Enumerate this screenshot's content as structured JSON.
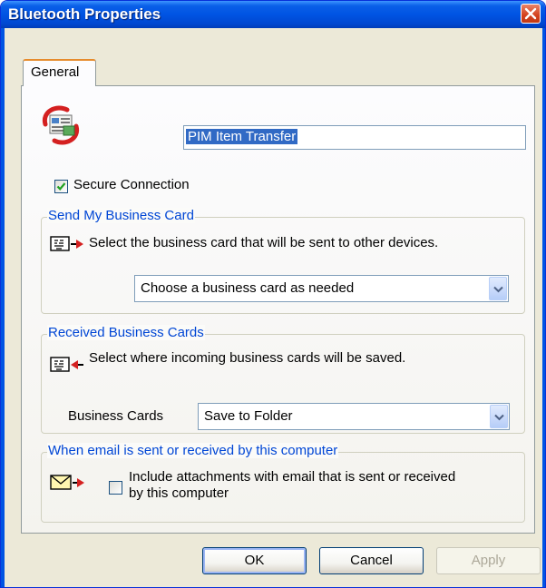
{
  "window": {
    "title": "Bluetooth Properties",
    "close_icon": "close-icon"
  },
  "tabs": [
    {
      "label": "General",
      "selected": true
    }
  ],
  "service": {
    "icon": "pim-transfer-icon",
    "name": "PIM Item Transfer"
  },
  "secure_connection": {
    "label": "Secure Connection",
    "checked": true
  },
  "send_card": {
    "legend": "Send My Business Card",
    "icon": "business-card-send-icon",
    "description": "Select the business card that will be sent to other devices.",
    "dropdown_value": "Choose a business card as needed"
  },
  "received_cards": {
    "legend": "Received Business Cards",
    "icon": "business-card-receive-icon",
    "description": "Select where incoming business cards will be saved.",
    "field_label": "Business Cards",
    "dropdown_value": "Save to Folder"
  },
  "email": {
    "legend": "When email is sent or received by this computer",
    "icon": "email-send-icon",
    "checkbox_line1": "Include attachments with email that is sent or received",
    "checkbox_line2": "by this computer",
    "checked": false
  },
  "buttons": {
    "ok": "OK",
    "cancel": "Cancel",
    "apply": "Apply"
  },
  "colors": {
    "title_bar": "#0054e3",
    "legend_text": "#0046d5",
    "dialog_bg": "#ece9d8",
    "close_button": "#d3411c",
    "tab_highlight": "#e68b2c"
  }
}
